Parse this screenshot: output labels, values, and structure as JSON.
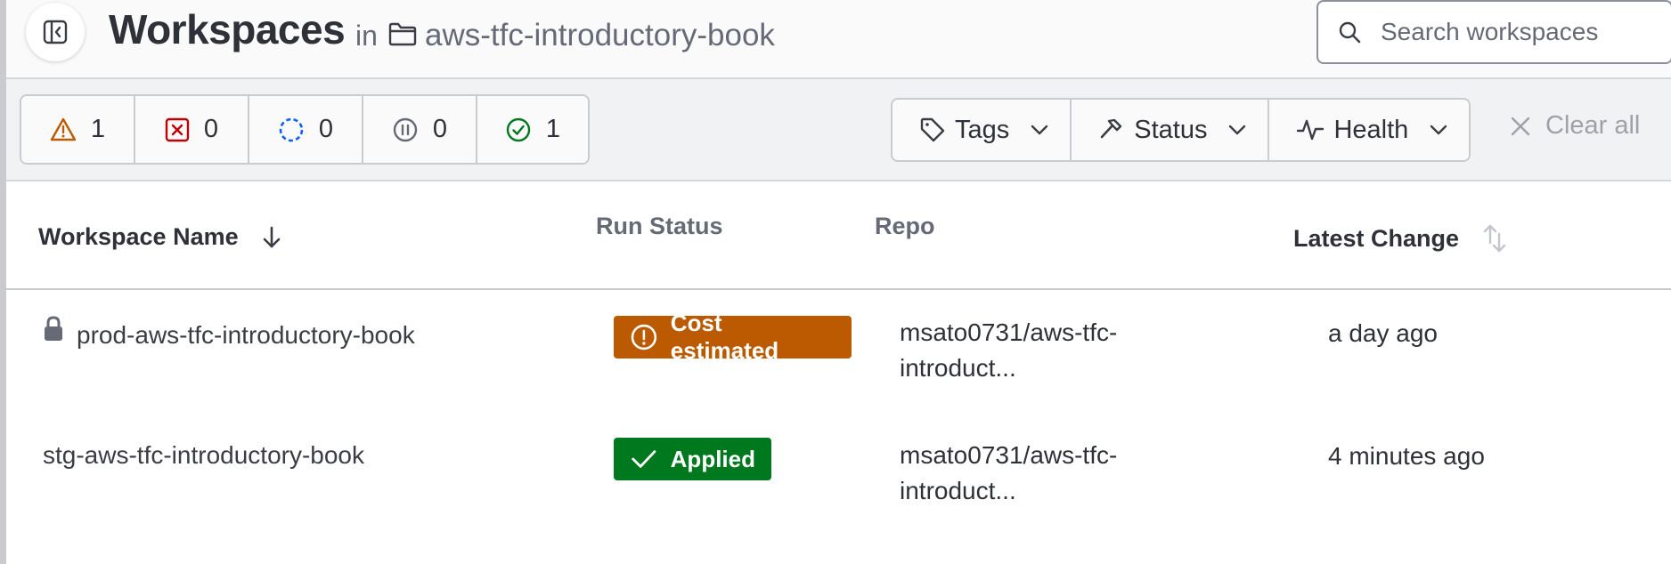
{
  "header": {
    "title": "Workspaces",
    "in_label": "in",
    "organization": "aws-tfc-introductory-book",
    "search_placeholder": "Search workspaces"
  },
  "status_filters": [
    {
      "icon": "warning-triangle-icon",
      "count": "1",
      "color": "#bb5a00"
    },
    {
      "icon": "error-x-square-icon",
      "count": "0",
      "color": "#c00005"
    },
    {
      "icon": "loading-circle-icon",
      "count": "0",
      "color": "#1060ff"
    },
    {
      "icon": "pause-circle-icon",
      "count": "0",
      "color": "#656a76"
    },
    {
      "icon": "check-circle-icon",
      "count": "1",
      "color": "#00781e"
    }
  ],
  "filters": {
    "tags": "Tags",
    "status": "Status",
    "health": "Health",
    "clear_all": "Clear all"
  },
  "table": {
    "columns": {
      "name": "Workspace Name",
      "run_status": "Run Status",
      "repo": "Repo",
      "latest_change": "Latest Change"
    },
    "rows": [
      {
        "name": "prod-aws-tfc-introductory-book",
        "locked": true,
        "run_status": "Cost estimated",
        "status_color": "#bb5a00",
        "repo_line1": "msato0731/aws-tfc-",
        "repo_line2": "introduct...",
        "latest_change": "a day ago"
      },
      {
        "name": "stg-aws-tfc-introductory-book",
        "locked": false,
        "run_status": "Applied",
        "status_color": "#00781e",
        "repo_line1": "msato0731/aws-tfc-",
        "repo_line2": "introduct...",
        "latest_change": "4 minutes ago"
      }
    ]
  }
}
